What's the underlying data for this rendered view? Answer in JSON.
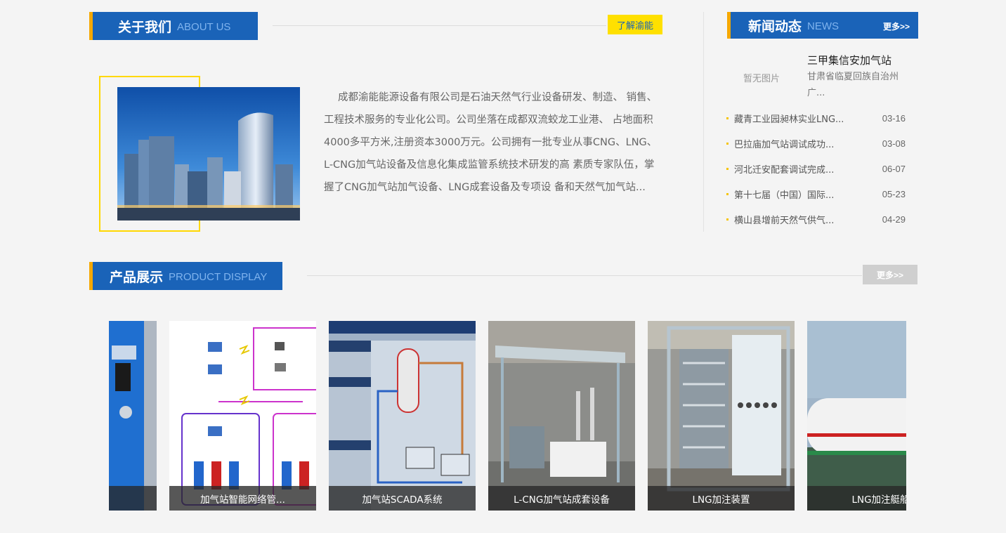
{
  "about": {
    "title_cn": "关于我们",
    "title_en": "ABOUT US",
    "learn_more": "了解渝能",
    "text": "成都渝能能源设备有限公司是石油天然气行业设备研发、制造、 销售、工程技术服务的专业化公司。公司坐落在成都双流蛟龙工业港、 占地面积4000多平方米,注册资本3000万元。公司拥有一批专业从事CNG、LNG、L-CNG加气站设备及信息化集成监管系统技术研发的高 素质专家队伍，掌握了CNG加气站加气设备、LNG成套设备及专项设 备和天然气加气站..."
  },
  "news": {
    "title_cn": "新闻动态",
    "title_en": "NEWS",
    "more": "更多>>",
    "featured": {
      "no_image": "暂无图片",
      "title": "三甲集信安加气站",
      "desc": "甘肃省临夏回族自治州广..."
    },
    "items": [
      {
        "title": "藏青工业园昶林实业LNG...",
        "date": "03-16"
      },
      {
        "title": "巴拉庙加气站调试成功...",
        "date": "03-08"
      },
      {
        "title": "河北迁安配套调试完成...",
        "date": "06-07"
      },
      {
        "title": "第十七届（中国）国际...",
        "date": "05-23"
      },
      {
        "title": "横山县增前天然气供气...",
        "date": "04-29"
      }
    ]
  },
  "products": {
    "title_cn": "产品展示",
    "title_en": "PRODUCT DISPLAY",
    "more": "更多>>",
    "items": [
      {
        "caption": "",
        "icon": "dispenser-image"
      },
      {
        "caption": "加气站智能网络管...",
        "icon": "network-diagram-image"
      },
      {
        "caption": "加气站SCADA系统",
        "icon": "scada-screen-image"
      },
      {
        "caption": "L-CNG加气站成套设备",
        "icon": "lcng-equipment-image"
      },
      {
        "caption": "LNG加注装置",
        "icon": "lng-skid-image"
      },
      {
        "caption": "LNG加注艇船",
        "icon": "lng-tank-image"
      }
    ]
  },
  "colors": {
    "brand_blue": "#1a63b8",
    "accent_yellow": "#ffe000",
    "accent_orange": "#f5a800"
  }
}
